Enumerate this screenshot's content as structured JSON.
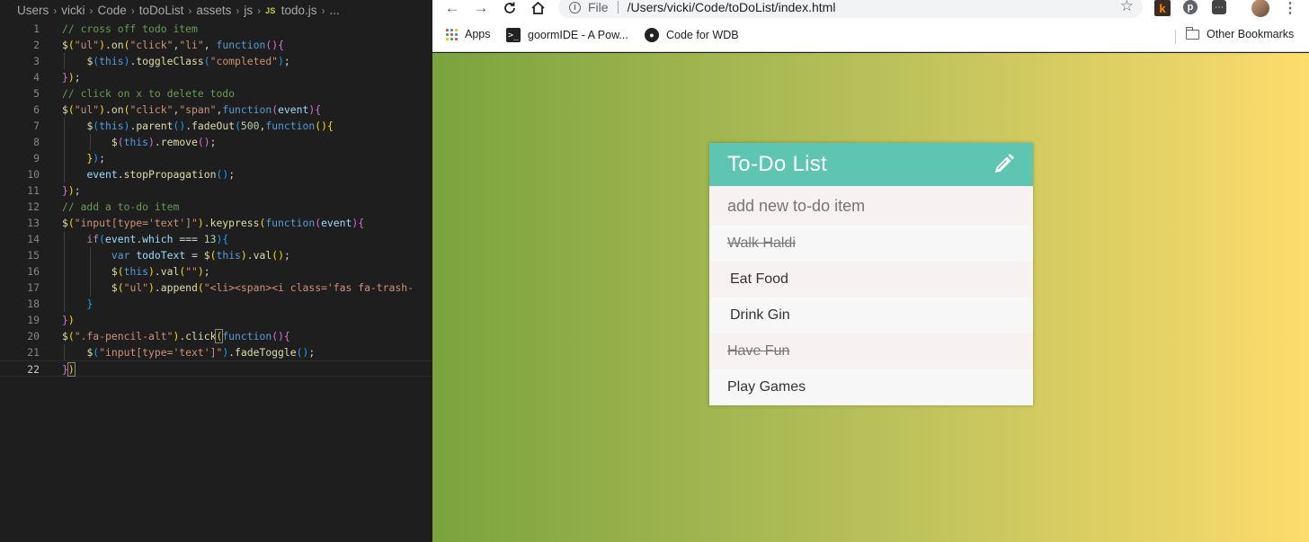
{
  "editor": {
    "breadcrumb": [
      "Users",
      "vicki",
      "Code",
      "toDoList",
      "assets",
      "js"
    ],
    "file_badge": "JS",
    "file_name": "todo.js",
    "breadcrumb_tail": "..."
  },
  "browser": {
    "omnibox": {
      "label": "File",
      "url": "/Users/vicki/Code/toDoList/index.html"
    },
    "extensions": {
      "k": "k",
      "pin": "p",
      "box": "⋯"
    },
    "bookmarks": {
      "apps": "Apps",
      "goorm": "goormIDE - A Pow...",
      "wdb": "Code for WDB",
      "other": "Other Bookmarks"
    }
  },
  "todo": {
    "title": "To-Do List",
    "input_placeholder": "add new to-do item",
    "items": [
      {
        "text": "Walk Haldi",
        "completed": true
      },
      {
        "text": "Eat Food",
        "completed": false
      },
      {
        "text": "Drink Gin",
        "completed": false
      },
      {
        "text": "Have Fun",
        "completed": true
      },
      {
        "text": "Play Games",
        "completed": false
      }
    ]
  },
  "colors": {
    "header": "#5fc5b3",
    "gradient_start": "#7aa33e",
    "gradient_end": "#fddc6c",
    "editor_bg": "#1e1e1e"
  }
}
